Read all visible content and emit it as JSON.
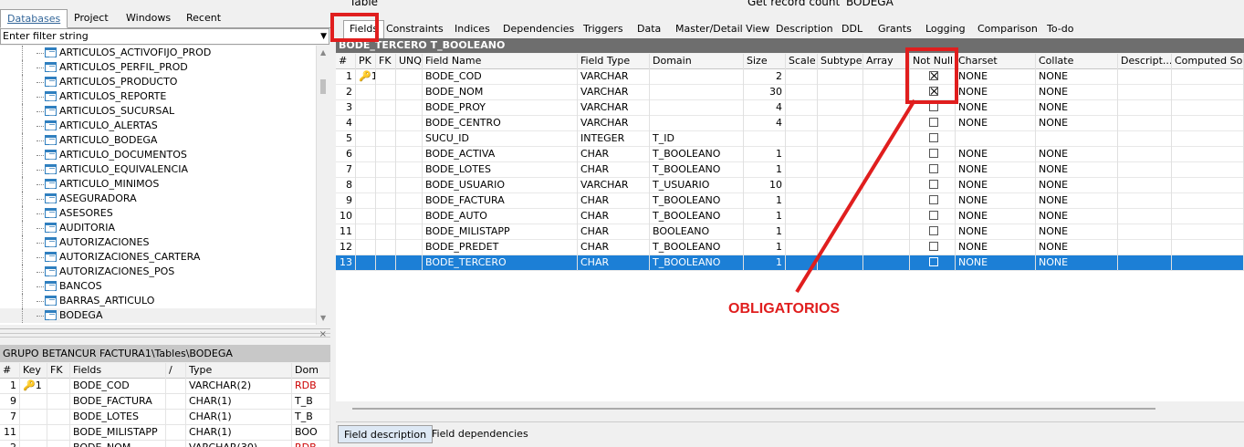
{
  "left_tabs": [
    "Databases",
    "Project",
    "Windows",
    "Recent"
  ],
  "filter": {
    "placeholder": "Enter filter string"
  },
  "tree_items": [
    "ARTICULOS_ACTIVOFIJO_PROD",
    "ARTICULOS_PERFIL_PROD",
    "ARTICULOS_PRODUCTO",
    "ARTICULOS_REPORTE",
    "ARTICULOS_SUCURSAL",
    "ARTICULO_ALERTAS",
    "ARTICULO_BODEGA",
    "ARTICULO_DOCUMENTOS",
    "ARTICULO_EQUIVALENCIA",
    "ARTICULO_MINIMOS",
    "ASEGURADORA",
    "ASESORES",
    "AUDITORIA",
    "AUTORIZACIONES",
    "AUTORIZACIONES_CARTERA",
    "AUTORIZACIONES_POS",
    "BANCOS",
    "BARRAS_ARTICULO",
    "BODEGA"
  ],
  "lower_panel": {
    "title": "GRUPO BETANCUR FACTURA1\\Tables\\BODEGA",
    "headers": [
      "#",
      "Key",
      "FK",
      "Fields",
      "/",
      "Type",
      "Dom"
    ],
    "rows": [
      {
        "num": "1",
        "key": "🔑1",
        "field": "BODE_COD",
        "type": "VARCHAR(2)",
        "dom": "RDB"
      },
      {
        "num": "9",
        "key": "",
        "field": "BODE_FACTURA",
        "type": "CHAR(1)",
        "dom": "T_B"
      },
      {
        "num": "7",
        "key": "",
        "field": "BODE_LOTES",
        "type": "CHAR(1)",
        "dom": "T_B"
      },
      {
        "num": "11",
        "key": "",
        "field": "BODE_MILISTAPP",
        "type": "CHAR(1)",
        "dom": "BOO"
      },
      {
        "num": "2",
        "key": "",
        "field": "BODE_NOM",
        "type": "VARCHAR(30)",
        "dom": "RDB"
      }
    ]
  },
  "toolbar": {
    "table_label": "Table",
    "record_count": "Get record count",
    "db_name": "BODEGA"
  },
  "right_tabs": [
    "Fields",
    "Constraints",
    "Indices",
    "Dependencies",
    "Triggers",
    "Data",
    "Master/Detail View",
    "Description",
    "DDL",
    "Grants",
    "Logging",
    "Comparison",
    "To-do"
  ],
  "table_title": "BODE_TERCERO T_BOOLEANO",
  "grid_headers": [
    "#",
    "PK",
    "FK",
    "UNQ",
    "Field Name",
    "Field Type",
    "Domain",
    "Size",
    "Scale",
    "Subtype",
    "Array",
    "Not Null",
    "Charset",
    "Collate",
    "Descript...",
    "Computed Source"
  ],
  "grid_rows": [
    {
      "n": "1",
      "pk": "🔑1",
      "name": "BODE_COD",
      "type": "VARCHAR",
      "domain": "",
      "size": "2",
      "notnull": true,
      "charset": "NONE",
      "collate": "NONE"
    },
    {
      "n": "2",
      "pk": "",
      "name": "BODE_NOM",
      "type": "VARCHAR",
      "domain": "",
      "size": "30",
      "notnull": true,
      "charset": "NONE",
      "collate": "NONE"
    },
    {
      "n": "3",
      "pk": "",
      "name": "BODE_PROY",
      "type": "VARCHAR",
      "domain": "",
      "size": "4",
      "notnull": false,
      "charset": "NONE",
      "collate": "NONE"
    },
    {
      "n": "4",
      "pk": "",
      "name": "BODE_CENTRO",
      "type": "VARCHAR",
      "domain": "",
      "size": "4",
      "notnull": false,
      "charset": "NONE",
      "collate": "NONE"
    },
    {
      "n": "5",
      "pk": "",
      "name": "SUCU_ID",
      "type": "INTEGER",
      "domain": "T_ID",
      "size": "",
      "notnull": false,
      "charset": "",
      "collate": ""
    },
    {
      "n": "6",
      "pk": "",
      "name": "BODE_ACTIVA",
      "type": "CHAR",
      "domain": "T_BOOLEANO",
      "size": "1",
      "notnull": false,
      "charset": "NONE",
      "collate": "NONE"
    },
    {
      "n": "7",
      "pk": "",
      "name": "BODE_LOTES",
      "type": "CHAR",
      "domain": "T_BOOLEANO",
      "size": "1",
      "notnull": false,
      "charset": "NONE",
      "collate": "NONE"
    },
    {
      "n": "8",
      "pk": "",
      "name": "BODE_USUARIO",
      "type": "VARCHAR",
      "domain": "T_USUARIO",
      "size": "10",
      "notnull": false,
      "charset": "NONE",
      "collate": "NONE"
    },
    {
      "n": "9",
      "pk": "",
      "name": "BODE_FACTURA",
      "type": "CHAR",
      "domain": "T_BOOLEANO",
      "size": "1",
      "notnull": false,
      "charset": "NONE",
      "collate": "NONE"
    },
    {
      "n": "10",
      "pk": "",
      "name": "BODE_AUTO",
      "type": "CHAR",
      "domain": "T_BOOLEANO",
      "size": "1",
      "notnull": false,
      "charset": "NONE",
      "collate": "NONE"
    },
    {
      "n": "11",
      "pk": "",
      "name": "BODE_MILISTAPP",
      "type": "CHAR",
      "domain": "BOOLEANO",
      "size": "1",
      "notnull": false,
      "charset": "NONE",
      "collate": "NONE"
    },
    {
      "n": "12",
      "pk": "",
      "name": "BODE_PREDET",
      "type": "CHAR",
      "domain": "T_BOOLEANO",
      "size": "1",
      "notnull": false,
      "charset": "NONE",
      "collate": "NONE"
    },
    {
      "n": "13",
      "pk": "",
      "name": "BODE_TERCERO",
      "type": "CHAR",
      "domain": "T_BOOLEANO",
      "size": "1",
      "notnull": false,
      "charset": "NONE",
      "collate": "NONE",
      "selected": true
    }
  ],
  "bottom_tabs": [
    "Field description",
    "Field dependencies"
  ],
  "annotation": {
    "text": "OBLIGATORIOS",
    "color": "#e01e1e"
  },
  "colors": {
    "selection": "#1c7fd6",
    "title_bar": "#6e6e6e",
    "annotation": "#e01e1e"
  }
}
